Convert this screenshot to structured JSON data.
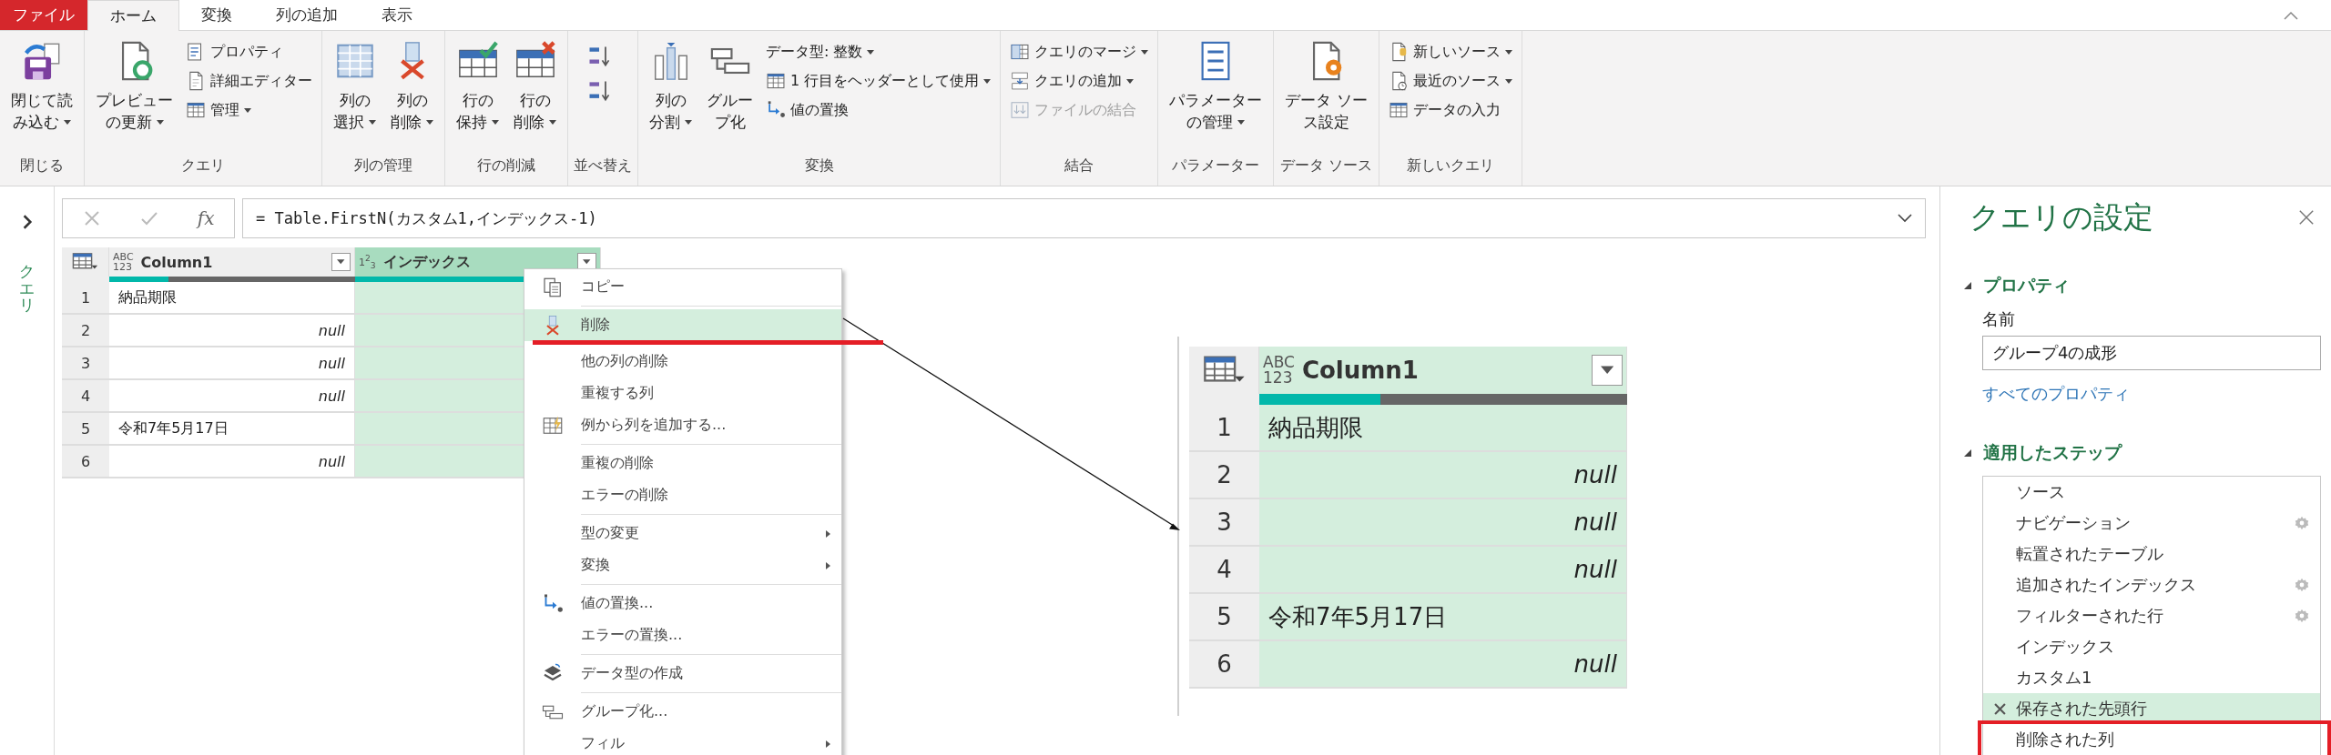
{
  "tabs": [
    {
      "label": "ファイル",
      "kind": "file",
      "selected": false
    },
    {
      "label": "ホーム",
      "kind": "tab",
      "selected": true
    },
    {
      "label": "変換",
      "kind": "tab",
      "selected": false
    },
    {
      "label": "列の追加",
      "kind": "tab",
      "selected": false
    },
    {
      "label": "表示",
      "kind": "tab",
      "selected": false
    }
  ],
  "ribbon": {
    "groups": [
      {
        "label": "閉じる",
        "items": [
          {
            "kind": "large",
            "lines": [
              "閉じて読",
              "み込む"
            ],
            "dropdown": true
          }
        ]
      },
      {
        "label": "クエリ",
        "items": [
          {
            "kind": "large",
            "lines": [
              "プレビュー",
              "の更新"
            ],
            "dropdown": true
          },
          {
            "kind": "stack",
            "buttons": [
              {
                "label": "プロパティ",
                "dropdown": false,
                "disabled": false
              },
              {
                "label": "詳細エディター",
                "dropdown": false,
                "disabled": false
              },
              {
                "label": "管理",
                "dropdown": true,
                "disabled": false
              }
            ]
          }
        ]
      },
      {
        "label": "列の管理",
        "items": [
          {
            "kind": "large",
            "lines": [
              "列の",
              "選択"
            ],
            "dropdown": true
          },
          {
            "kind": "large",
            "lines": [
              "列の",
              "削除"
            ],
            "dropdown": true
          }
        ]
      },
      {
        "label": "行の削減",
        "items": [
          {
            "kind": "large",
            "lines": [
              "行の",
              "保持"
            ],
            "dropdown": true
          },
          {
            "kind": "large",
            "lines": [
              "行の",
              "削除"
            ],
            "dropdown": true
          }
        ]
      },
      {
        "label": "並べ替え",
        "items": [
          {
            "kind": "sort"
          }
        ]
      },
      {
        "label": "変換",
        "items": [
          {
            "kind": "large",
            "lines": [
              "列の",
              "分割"
            ],
            "dropdown": true
          },
          {
            "kind": "large",
            "lines": [
              "グルー",
              "プ化"
            ],
            "dropdown": false
          },
          {
            "kind": "stack",
            "buttons": [
              {
                "label": "データ型: 整数",
                "dropdown": true,
                "disabled": false
              },
              {
                "label": "1 行目をヘッダーとして使用",
                "dropdown": true,
                "disabled": false
              },
              {
                "label": "値の置換",
                "dropdown": false,
                "disabled": false
              }
            ]
          }
        ]
      },
      {
        "label": "結合",
        "items": [
          {
            "kind": "stack",
            "buttons": [
              {
                "label": "クエリのマージ",
                "dropdown": true,
                "disabled": false
              },
              {
                "label": "クエリの追加",
                "dropdown": true,
                "disabled": false
              },
              {
                "label": "ファイルの結合",
                "dropdown": false,
                "disabled": true
              }
            ]
          }
        ]
      },
      {
        "label": "パラメーター",
        "items": [
          {
            "kind": "large",
            "lines": [
              "パラメーター",
              "の管理"
            ],
            "dropdown": true
          }
        ]
      },
      {
        "label": "データ ソース",
        "items": [
          {
            "kind": "large",
            "lines": [
              "データ ソー",
              "ス設定"
            ],
            "dropdown": false
          }
        ]
      },
      {
        "label": "新しいクエリ",
        "items": [
          {
            "kind": "stack",
            "buttons": [
              {
                "label": "新しいソース",
                "dropdown": true,
                "disabled": false
              },
              {
                "label": "最近のソース",
                "dropdown": true,
                "disabled": false
              },
              {
                "label": "データの入力",
                "dropdown": false,
                "disabled": false
              }
            ]
          }
        ]
      }
    ]
  },
  "queries_pane": {
    "label": "クエリ",
    "expanded": false
  },
  "formula_bar": {
    "fx": "fx",
    "formula": "= Table.FirstN(カスタム1,インデックス-1)"
  },
  "table": {
    "columns": [
      {
        "type_lines": [
          "ABC",
          "123"
        ],
        "name": "Column1",
        "selected": false,
        "level": 0.24
      },
      {
        "type_lines": [
          "1$^{2}$$_{3}$"
        ],
        "name": "インデックス",
        "selected": true,
        "level": 1
      }
    ],
    "rows": [
      {
        "num": "1",
        "value": {
          "kind": "text",
          "text": "納品期限"
        }
      },
      {
        "num": "2",
        "value": {
          "kind": "null",
          "text": "null"
        }
      },
      {
        "num": "3",
        "value": {
          "kind": "null",
          "text": "null"
        }
      },
      {
        "num": "4",
        "value": {
          "kind": "null",
          "text": "null"
        }
      },
      {
        "num": "5",
        "value": {
          "kind": "text",
          "text": "令和7年5月17日"
        }
      },
      {
        "num": "6",
        "value": {
          "kind": "null",
          "text": "null"
        }
      }
    ]
  },
  "context_menu": {
    "items": [
      {
        "label": "コピー",
        "selected": false,
        "submenu": false,
        "divider_after": true
      },
      {
        "label": "削除",
        "selected": true,
        "submenu": false,
        "divider_after": false
      },
      {
        "label": "他の列の削除",
        "selected": false,
        "submenu": false,
        "divider_after": false
      },
      {
        "label": "重複する列",
        "selected": false,
        "submenu": false,
        "divider_after": false
      },
      {
        "label": "例から列を追加する...",
        "selected": false,
        "submenu": false,
        "divider_after": true
      },
      {
        "label": "重複の削除",
        "selected": false,
        "submenu": false,
        "divider_after": false
      },
      {
        "label": "エラーの削除",
        "selected": false,
        "submenu": false,
        "divider_after": true
      },
      {
        "label": "型の変更",
        "selected": false,
        "submenu": true,
        "divider_after": false
      },
      {
        "label": "変換",
        "selected": false,
        "submenu": true,
        "divider_after": true
      },
      {
        "label": "値の置換...",
        "selected": false,
        "submenu": false,
        "divider_after": false
      },
      {
        "label": "エラーの置換...",
        "selected": false,
        "submenu": false,
        "divider_after": true
      },
      {
        "label": "データ型の作成",
        "selected": false,
        "submenu": false,
        "divider_after": true
      },
      {
        "label": "グループ化...",
        "selected": false,
        "submenu": false,
        "divider_after": false
      },
      {
        "label": "フィル",
        "selected": false,
        "submenu": true,
        "divider_after": false
      }
    ]
  },
  "zoomed_table": {
    "columns": [
      {
        "type_lines": [
          "ABC",
          "123"
        ],
        "name": "Column1",
        "selected": true,
        "level": 0.33
      }
    ],
    "rows": [
      {
        "num": "1",
        "value": {
          "kind": "text",
          "text": "納品期限"
        }
      },
      {
        "num": "2",
        "value": {
          "kind": "null",
          "text": "null"
        }
      },
      {
        "num": "3",
        "value": {
          "kind": "null",
          "text": "null"
        }
      },
      {
        "num": "4",
        "value": {
          "kind": "null",
          "text": "null"
        }
      },
      {
        "num": "5",
        "value": {
          "kind": "text",
          "text": "令和7年5月17日"
        }
      },
      {
        "num": "6",
        "value": {
          "kind": "null",
          "text": "null"
        }
      }
    ]
  },
  "settings": {
    "title": "クエリの設定",
    "properties": {
      "heading": "プロパティ",
      "expanded": true,
      "name_label": "名前",
      "name_value": "グループ4の成形",
      "link": "すべてのプロパティ"
    },
    "steps": {
      "heading": "適用したステップ",
      "expanded": true,
      "items": [
        {
          "label": "ソース",
          "settings": false,
          "selected": false
        },
        {
          "label": "ナビゲーション",
          "settings": true,
          "selected": false
        },
        {
          "label": "転置されたテーブル",
          "settings": false,
          "selected": false
        },
        {
          "label": "追加されたインデックス",
          "settings": true,
          "selected": false
        },
        {
          "label": "フィルターされた行",
          "settings": true,
          "selected": false
        },
        {
          "label": "インデックス",
          "settings": false,
          "selected": false
        },
        {
          "label": "カスタム1",
          "settings": false,
          "selected": false
        },
        {
          "label": "保存された先頭行",
          "settings": false,
          "selected": true
        },
        {
          "label": "削除された列",
          "settings": false,
          "selected": false
        }
      ]
    }
  }
}
